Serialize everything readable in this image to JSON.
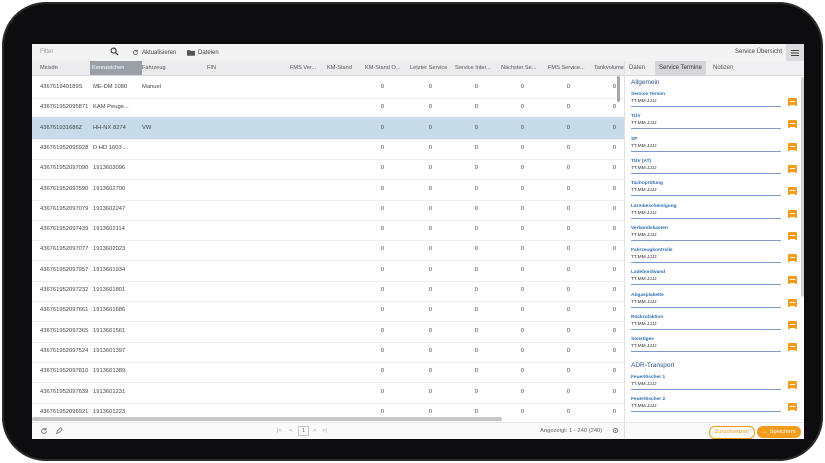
{
  "toolbar": {
    "filter_placeholder": "Filter",
    "refresh_label": "Aktualisieren",
    "files_label": "Dateien",
    "title": "Service Übersicht"
  },
  "columns": [
    "Msisdn",
    "Kennzeichen",
    "Fahrzeug",
    "FIN",
    "FMS Ver...",
    "KM-Stand",
    "KM-Stand O...",
    "Letzter Service",
    "Service Inter...",
    "Nächster Se...",
    "FMS Service...",
    "Tankvolumen"
  ],
  "rows": [
    {
      "msisdn": "436761949189S",
      "kennzeichen": "ME-DM 1080",
      "fahrzeug": "Manuel",
      "vals": [
        "0",
        "0",
        "0",
        "0",
        "0",
        "0"
      ]
    },
    {
      "msisdn": "436761952095871",
      "kennzeichen": "KAM Peuge...",
      "fahrzeug": "",
      "vals": [
        "0",
        "0",
        "0",
        "0",
        "0",
        "0"
      ]
    },
    {
      "msisdn": "436761931686Z",
      "kennzeichen": "HH-NX 8274",
      "fahrzeug": "VW",
      "vals": [
        "0",
        "0",
        "0",
        "0",
        "0",
        "0"
      ]
    },
    {
      "msisdn": "436761952095928",
      "kennzeichen": "D HD 1603 ...",
      "fahrzeug": "",
      "vals": [
        "0",
        "0",
        "0",
        "0",
        "0",
        "0"
      ]
    },
    {
      "msisdn": "436761952097090",
      "kennzeichen": "1913603096",
      "fahrzeug": "",
      "vals": [
        "0",
        "0",
        "0",
        "0",
        "0",
        "0"
      ]
    },
    {
      "msisdn": "436761952097590",
      "kennzeichen": "1913602700",
      "fahrzeug": "",
      "vals": [
        "0",
        "0",
        "0",
        "0",
        "0",
        "0"
      ]
    },
    {
      "msisdn": "436761952097079",
      "kennzeichen": "1913602247",
      "fahrzeug": "",
      "vals": [
        "0",
        "0",
        "0",
        "0",
        "0",
        "0"
      ]
    },
    {
      "msisdn": "436761952097439",
      "kennzeichen": "1913602114",
      "fahrzeug": "",
      "vals": [
        "0",
        "0",
        "0",
        "0",
        "0",
        "0"
      ]
    },
    {
      "msisdn": "436761952097077",
      "kennzeichen": "1913602023",
      "fahrzeug": "",
      "vals": [
        "0",
        "0",
        "0",
        "0",
        "0",
        "0"
      ]
    },
    {
      "msisdn": "436761952097957",
      "kennzeichen": "1913601934",
      "fahrzeug": "",
      "vals": [
        "0",
        "0",
        "0",
        "0",
        "0",
        "0"
      ]
    },
    {
      "msisdn": "436761952097232",
      "kennzeichen": "1913601801",
      "fahrzeug": "",
      "vals": [
        "0",
        "0",
        "0",
        "0",
        "0",
        "0"
      ]
    },
    {
      "msisdn": "436761952097661",
      "kennzeichen": "1913601686",
      "fahrzeug": "",
      "vals": [
        "0",
        "0",
        "0",
        "0",
        "0",
        "0"
      ]
    },
    {
      "msisdn": "436761952097365",
      "kennzeichen": "1913601561",
      "fahrzeug": "",
      "vals": [
        "0",
        "0",
        "0",
        "0",
        "0",
        "0"
      ]
    },
    {
      "msisdn": "436761952097524",
      "kennzeichen": "1913601397",
      "fahrzeug": "",
      "vals": [
        "0",
        "0",
        "0",
        "0",
        "0",
        "0"
      ]
    },
    {
      "msisdn": "436761952097810",
      "kennzeichen": "1913601389",
      "fahrzeug": "",
      "vals": [
        "0",
        "0",
        "0",
        "0",
        "0",
        "0"
      ]
    },
    {
      "msisdn": "436761952097639",
      "kennzeichen": "1913601231",
      "fahrzeug": "",
      "vals": [
        "0",
        "0",
        "0",
        "0",
        "0",
        "0"
      ]
    },
    {
      "msisdn": "436761952096921",
      "kennzeichen": "1913601223",
      "fahrzeug": "",
      "vals": [
        "0",
        "0",
        "0",
        "0",
        "0",
        "0"
      ]
    }
  ],
  "footer": {
    "pager_first": "|<",
    "pager_prev": "<",
    "pager_page": "1",
    "pager_next": ">",
    "pager_last": ">|",
    "count": "Angezeigt: 1 - 240 (240)"
  },
  "panel": {
    "tabs": [
      "Daten",
      "Service Termine",
      "Notizen"
    ],
    "section1": "Allgemein",
    "fields1": [
      {
        "label": "Service Termin",
        "value": "TT.MM.JJJJ"
      },
      {
        "label": "TÜV",
        "value": "TT.MM.JJJJ"
      },
      {
        "label": "SP",
        "value": "TT.MM.JJJJ"
      },
      {
        "label": "TÜV (AT)",
        "value": "TT.MM.JJJJ"
      },
      {
        "label": "Tachoprüfung",
        "value": "TT.MM.JJJJ"
      },
      {
        "label": "Lärmbescheinigung",
        "value": "TT.MM.JJJJ"
      },
      {
        "label": "Verbandskasten",
        "value": "TT.MM.JJJJ"
      },
      {
        "label": "Fahrzeugkontrolle",
        "value": "TT.MM.JJJJ"
      },
      {
        "label": "Ladebordwand",
        "value": "TT.MM.JJJJ"
      },
      {
        "label": "Abgasplakette",
        "value": "TT.MM.JJJJ"
      },
      {
        "label": "Rückrufaktion",
        "value": "TT.MM.JJJJ"
      },
      {
        "label": "Sonstiges",
        "value": "TT.MM.JJJJ"
      }
    ],
    "section2": "ADR-Transport",
    "fields2": [
      {
        "label": "Feuerlöscher 1",
        "value": "TT.MM.JJJJ"
      },
      {
        "label": "Feuerlöscher 2",
        "value": "TT.MM.JJJJ"
      }
    ],
    "reset_label": "Zurücksetzen",
    "save_label": "Speichern"
  },
  "colors": {
    "accent": "#f39c1c",
    "selected_row": "#c7dbe8",
    "label_blue": "#2c6fb3"
  }
}
